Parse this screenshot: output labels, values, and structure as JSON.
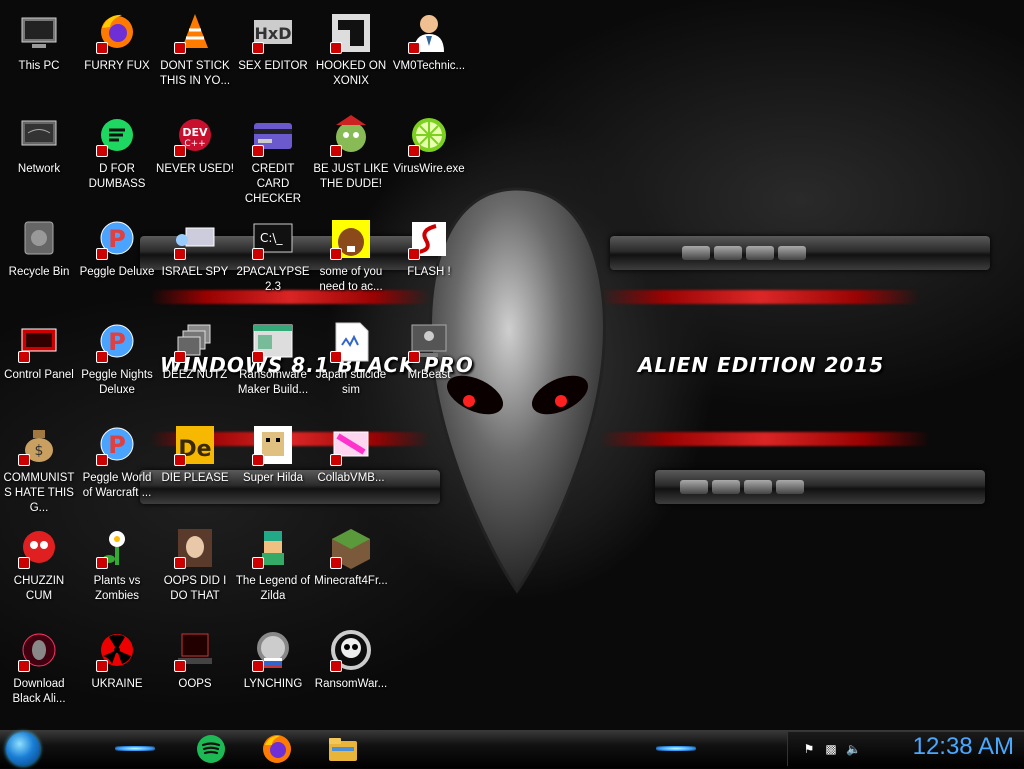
{
  "wallpaper": {
    "text_left": "WINDOWS 8.1 BLACK PRO",
    "text_right": "ALIEN EDITION 2015"
  },
  "icons": [
    {
      "label": "This PC",
      "icon": "computer-icon"
    },
    {
      "label": "Network",
      "icon": "network-icon"
    },
    {
      "label": "Recycle Bin",
      "icon": "recycle-bin-icon"
    },
    {
      "label": "Control Panel",
      "icon": "control-panel-icon"
    },
    {
      "label": "COMMUNISTS HATE THIS G...",
      "icon": "money-bag-icon"
    },
    {
      "label": "CHUZZIN CUM",
      "icon": "chuzzle-icon"
    },
    {
      "label": "Download Black Ali...",
      "icon": "alien-download-icon"
    },
    {
      "label": "FURRY FUX",
      "icon": "firefox-icon"
    },
    {
      "label": "D FOR DUMBASS",
      "icon": "green-chat-icon"
    },
    {
      "label": "Peggle Deluxe",
      "icon": "peggle-icon"
    },
    {
      "label": "Peggle Nights Deluxe",
      "icon": "peggle-icon"
    },
    {
      "label": "Peggle World of Warcraft ...",
      "icon": "peggle-icon"
    },
    {
      "label": "Plants vs Zombies",
      "icon": "plant-icon"
    },
    {
      "label": "UKRAINE",
      "icon": "radiation-icon"
    },
    {
      "label": "DONT STICK THIS IN YO...",
      "icon": "traffic-cone-icon"
    },
    {
      "label": "NEVER USED!",
      "icon": "dev-cpp-icon"
    },
    {
      "label": "ISRAEL SPY",
      "icon": "spy-icon"
    },
    {
      "label": "DEEZ NUTZ",
      "icon": "stack-icon"
    },
    {
      "label": "DIE PLEASE",
      "icon": "de-icon"
    },
    {
      "label": "OOPS DID I DO THAT",
      "icon": "portrait-icon"
    },
    {
      "label": "OOPS",
      "icon": "alien-laptop-icon"
    },
    {
      "label": "SEX EDITOR",
      "icon": "hxd-icon"
    },
    {
      "label": "CREDIT CARD CHECKER",
      "icon": "credit-card-icon"
    },
    {
      "label": "2PACALYPSE 2.3",
      "icon": "terminal-icon"
    },
    {
      "label": "Ransomware Maker Build...",
      "icon": "window-app-icon"
    },
    {
      "label": "Super Hilda",
      "icon": "pixel-sprite-icon"
    },
    {
      "label": "The Legend of Zilda",
      "icon": "zelda-sprite-icon"
    },
    {
      "label": "LYNCHING",
      "icon": "gear-flag-icon"
    },
    {
      "label": "HOOKED ON XONIX",
      "icon": "xonix-icon"
    },
    {
      "label": "BE JUST LIKE THE DUDE!",
      "icon": "elf-icon"
    },
    {
      "label": "some of you need to ac...",
      "icon": "beaver-icon"
    },
    {
      "label": "Japan suicide sim",
      "icon": "document-icon"
    },
    {
      "label": "CollabVMB...",
      "icon": "collabvm-icon"
    },
    {
      "label": "Minecraft4Fr...",
      "icon": "minecraft-icon"
    },
    {
      "label": "RansomWar...",
      "icon": "skull-icon"
    },
    {
      "label": "VM0Technic...",
      "icon": "doctor-icon"
    },
    {
      "label": "VirusWire.exe",
      "icon": "lime-icon"
    },
    {
      "label": "FLASH !",
      "icon": "flash-icon"
    },
    {
      "label": "MrBeast",
      "icon": "monitor-user-icon"
    }
  ],
  "taskbar": {
    "pinned": [
      "spotify-icon",
      "firefox-icon",
      "file-explorer-icon"
    ],
    "clock": "12:38 AM"
  }
}
